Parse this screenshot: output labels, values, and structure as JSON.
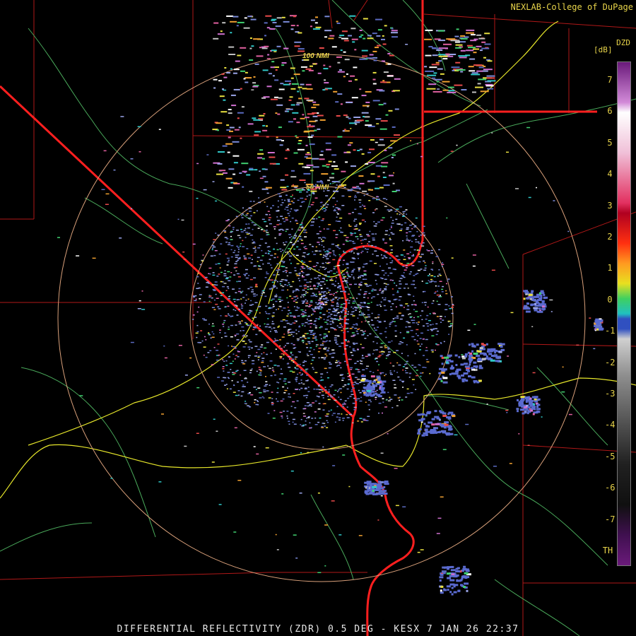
{
  "credit": "NEXLAB-College of DuPage",
  "caption": "DIFFERENTIAL REFLECTIVITY (ZDR) 0.5 DEG - KESX 7 JAN 26 22:37",
  "rings": [
    {
      "label": "100 NMI"
    },
    {
      "label": "50 NMI"
    }
  ],
  "legend": {
    "title": "DZD",
    "unit": "[dB]",
    "ticks": [
      "7",
      "6",
      "5",
      "4",
      "3",
      "2",
      "1",
      "0",
      "-1",
      "-2",
      "-3",
      "-4",
      "-5",
      "-6",
      "-7",
      "TH"
    ]
  },
  "colors": {
    "county_lines": "#b01818",
    "state_lines": "#ff1f1f",
    "highways": "#e6e62a",
    "rivers_roads": "#49a85a",
    "range_rings": "#d9a07a",
    "label_text": "#e8d44a"
  }
}
